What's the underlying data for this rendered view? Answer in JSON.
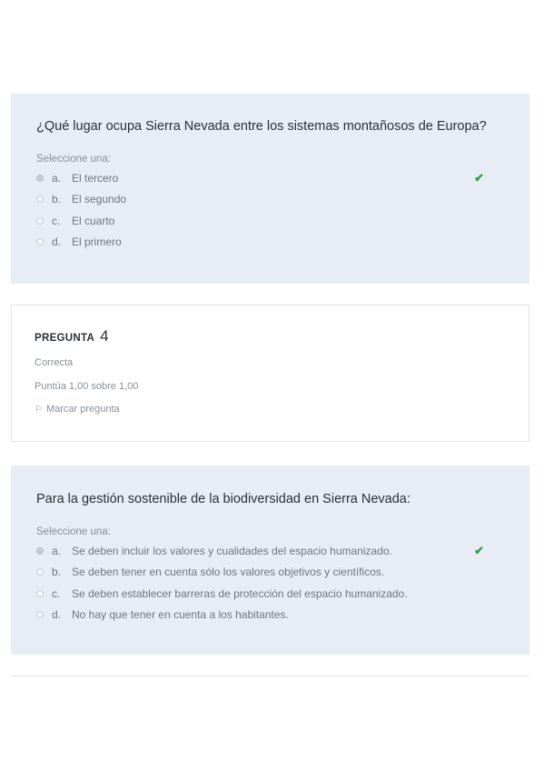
{
  "question3": {
    "text": "¿Qué lugar ocupa Sierra Nevada entre los sistemas montañosos de Europa?",
    "prompt": "Seleccione una:",
    "options": [
      {
        "letter": "a.",
        "label": "El tercero",
        "selected": true
      },
      {
        "letter": "b.",
        "label": "El segundo",
        "selected": false
      },
      {
        "letter": "c.",
        "label": "El cuarto",
        "selected": false
      },
      {
        "letter": "d.",
        "label": "El primero",
        "selected": false
      }
    ],
    "correct_icon": "check-icon"
  },
  "question4": {
    "label": "PREGUNTA",
    "number": "4",
    "status": "Correcta",
    "score": "Puntúa 1,00 sobre 1,00",
    "flag_label": "Marcar pregunta",
    "text": "Para la gestión sostenible de la biodiversidad en Sierra Nevada:",
    "prompt": "Seleccione una:",
    "options": [
      {
        "letter": "a.",
        "label": "Se deben incluir los valores y cualidades del espacio humanizado.",
        "selected": true
      },
      {
        "letter": "b.",
        "label": "Se deben tener en cuenta sólo los valores objetivos y científicos.",
        "selected": false
      },
      {
        "letter": "c.",
        "label": "Se deben establecer barreras de protección del espacio humanizado.",
        "selected": false
      },
      {
        "letter": "d.",
        "label": "No hay que tener en cuenta a los habitantes.",
        "selected": false
      }
    ],
    "correct_icon": "check-icon"
  },
  "colors": {
    "panel": "#e8ecf4",
    "correct": "#2e9e4b"
  }
}
